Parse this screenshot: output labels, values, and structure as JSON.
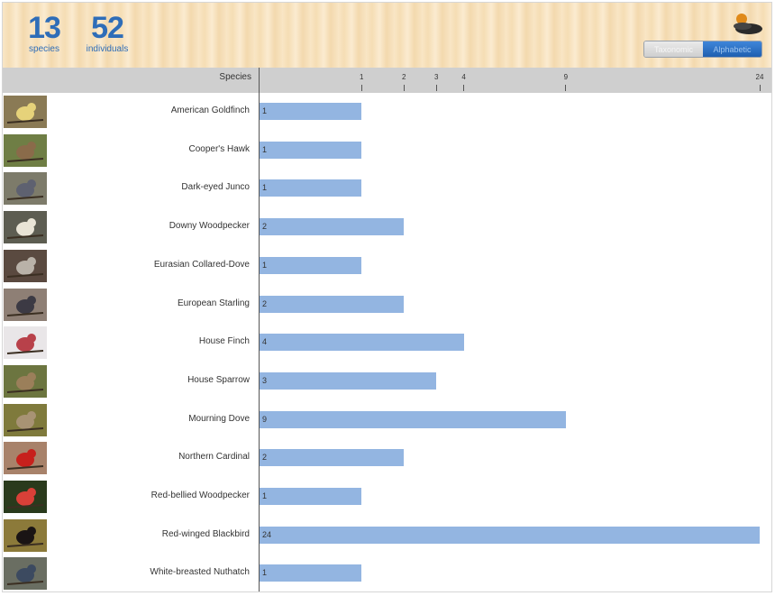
{
  "stats": {
    "species_count": "13",
    "species_label": "species",
    "individuals_count": "52",
    "individuals_label": "individuals"
  },
  "toggle": {
    "options": [
      "Taxonomic",
      "Alphabetic"
    ],
    "selected": "Alphabetic"
  },
  "colors": {
    "bar": "#93b5e1",
    "header_text": "#2e6db8",
    "toggle_selected": "#2a6fc4"
  },
  "chart_data": {
    "type": "bar",
    "orientation": "horizontal",
    "scale": "sqrt",
    "ylabel": "Species",
    "tick_values": [
      1,
      2,
      3,
      4,
      9,
      24
    ],
    "xlim": [
      0,
      24
    ],
    "categories": [
      "American Goldfinch",
      "Cooper's Hawk",
      "Dark-eyed Junco",
      "Downy Woodpecker",
      "Eurasian Collared-Dove",
      "European Starling",
      "House Finch",
      "House Sparrow",
      "Mourning Dove",
      "Northern Cardinal",
      "Red-bellied Woodpecker",
      "Red-winged Blackbird",
      "White-breasted Nuthatch"
    ],
    "values": [
      1,
      1,
      1,
      2,
      1,
      2,
      4,
      3,
      9,
      2,
      1,
      24,
      1
    ],
    "thumbnail_colors": [
      [
        "#8a7a55",
        "#e6d27a"
      ],
      [
        "#6f7e45",
        "#8a6b4a"
      ],
      [
        "#7d7b6a",
        "#5e6170"
      ],
      [
        "#5d5d52",
        "#e9e4d6"
      ],
      [
        "#5a4a40",
        "#b9b2a8"
      ],
      [
        "#8e7f75",
        "#3c3a44"
      ],
      [
        "#e9e6e8",
        "#b8414a"
      ],
      [
        "#6c7540",
        "#9b7f5a"
      ],
      [
        "#7f7a3c",
        "#a89374"
      ],
      [
        "#a8826a",
        "#c7201c"
      ],
      [
        "#2a3a1c",
        "#d94038"
      ],
      [
        "#8c7a3a",
        "#1a1414"
      ],
      [
        "#6a6e62",
        "#3c4a60"
      ]
    ]
  }
}
